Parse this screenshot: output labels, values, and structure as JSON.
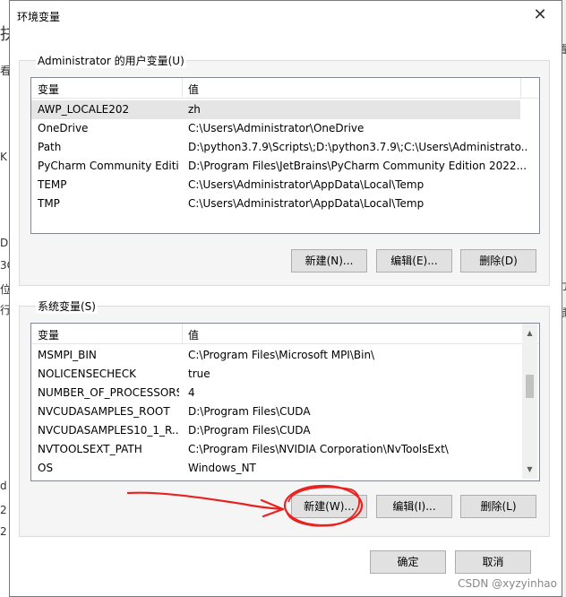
{
  "dialog": {
    "title": "环境变量",
    "close_glyph": "✕"
  },
  "user_vars": {
    "legend": "Administrator 的用户变量(U)",
    "col_var": "变量",
    "col_val": "值",
    "rows": [
      {
        "name": "AWP_LOCALE202",
        "value": "zh"
      },
      {
        "name": "OneDrive",
        "value": "C:\\Users\\Administrator\\OneDrive"
      },
      {
        "name": "Path",
        "value": "D:\\python3.7.9\\Scripts\\;D:\\python3.7.9\\;C:\\Users\\Administrato..."
      },
      {
        "name": "PyCharm Community Editi...",
        "value": "D:\\Program Files\\JetBrains\\PyCharm Community Edition 2022..."
      },
      {
        "name": "TEMP",
        "value": "C:\\Users\\Administrator\\AppData\\Local\\Temp"
      },
      {
        "name": "TMP",
        "value": "C:\\Users\\Administrator\\AppData\\Local\\Temp"
      }
    ],
    "new_button": "新建(N)...",
    "edit_button": "编辑(E)...",
    "delete_button": "删除(D)"
  },
  "system_vars": {
    "legend": "系统变量(S)",
    "col_var": "变量",
    "col_val": "值",
    "rows": [
      {
        "name": "MSMPI_BIN",
        "value": "C:\\Program Files\\Microsoft MPI\\Bin\\"
      },
      {
        "name": "NOLICENSECHECK",
        "value": "true"
      },
      {
        "name": "NUMBER_OF_PROCESSORS",
        "value": "4"
      },
      {
        "name": "NVCUDASAMPLES_ROOT",
        "value": "D:\\Program Files\\CUDA"
      },
      {
        "name": "NVCUDASAMPLES10_1_R...",
        "value": "D:\\Program Files\\CUDA"
      },
      {
        "name": "NVTOOLSEXT_PATH",
        "value": "C:\\Program Files\\NVIDIA Corporation\\NvToolsExt\\"
      },
      {
        "name": "OS",
        "value": "Windows_NT"
      }
    ],
    "scroll_position": 0.35,
    "new_button": "新建(W)...",
    "edit_button": "编辑(I)...",
    "delete_button": "删除(L)"
  },
  "footer": {
    "ok_button": "确定",
    "cancel_button": "取消"
  },
  "watermark": "CSDN @xyzyinhao",
  "background_glyphs": [
    "抉",
    "看",
    "C",
    "K",
    "(",
    "C",
    "D",
    "3C",
    "位",
    "行",
    "d",
    "2",
    "2",
    "置",
    "力",
    "鼠"
  ],
  "annotation": {
    "color": "#e8221f"
  }
}
